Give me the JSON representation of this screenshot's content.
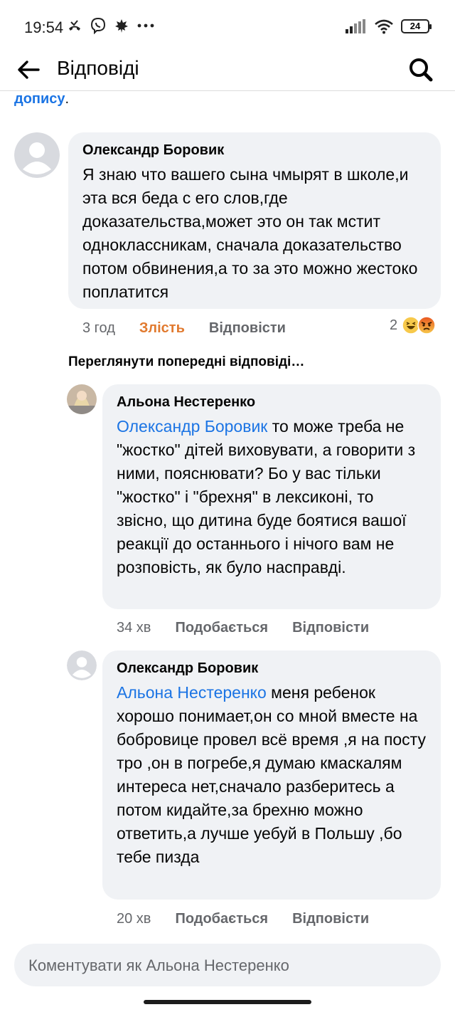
{
  "status_bar": {
    "time": "19:54",
    "battery": "24"
  },
  "header": {
    "title": "Відповіді"
  },
  "top_fragment": {
    "link": "допису",
    "punct": "."
  },
  "comments": [
    {
      "author": "Олександр Боровик",
      "mention": "",
      "text": "Я знаю что вашего сына чмырят в школе,и эта вся беда с его слов,где доказательства,может это он так мстит одноклассникам, сначала доказательство потом обвинения,а то за это можно жестоко поплатится",
      "time": "3 год",
      "reaction_label": "Злість",
      "reply_label": "Відповісти",
      "reaction_count": "2"
    },
    {
      "author": "Альона Нестеренко",
      "mention": "Олександр Боровик",
      "text": " то може треба не \"жостко\" дітей виховувати, а говорити з ними, пояснювати? Бо у вас тільки \"жостко\" і \"брехня\" в лексиконі, то звісно, що дитина буде боятися вашої реакції до останнього і нічого вам не розповість, як було насправді.",
      "time": "34 хв",
      "reaction_label": "Подобається",
      "reply_label": "Відповісти"
    },
    {
      "author": "Олександр Боровик",
      "mention": "Альона Нестеренко",
      "text": " меня ребенок хорошо понимает,он со мной вместе на бобровице провел всё время ,я на посту тро ,он в погребе,я думаю кмаскалям интереса нет,сначало разберитесь а потом кидайте,за брехню можно ответить,а лучше уебуй в Польшу ,бо тебе пизда",
      "time": "20 хв",
      "reaction_label": "Подобається",
      "reply_label": "Відповісти"
    }
  ],
  "view_previous": "Переглянути попередні відповіді…",
  "composer": {
    "placeholder": "Коментувати як Альона Нестеренко"
  },
  "icons": {
    "back": "arrow-left-icon",
    "search": "search-icon",
    "haha": "haha-reaction-icon",
    "angry": "angry-reaction-icon"
  },
  "colors": {
    "link": "#1b74e4",
    "anger": "#e17a2f",
    "bubble": "#f0f2f5",
    "muted": "#65676b"
  }
}
